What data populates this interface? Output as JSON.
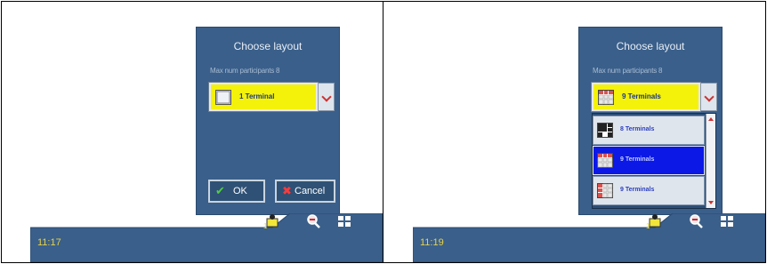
{
  "colors": {
    "dialog_bg": "#3a5f8a",
    "taskbar_bg": "#3a5f8a",
    "select_bg": "#f4f20a",
    "list_selected_bg": "#0b18e6",
    "clock_text": "#e6d24a"
  },
  "left": {
    "dialog": {
      "title": "Choose layout",
      "subtitle": "Max num participants 8",
      "selected_layout": "1 Terminal",
      "ok_label": "OK",
      "cancel_label": "Cancel"
    },
    "taskbar": {
      "clock": "11:17"
    }
  },
  "right": {
    "dialog": {
      "title": "Choose layout",
      "subtitle": "Max num participants 8",
      "selected_layout": "9 Terminals",
      "options": [
        "8 Terminals",
        "9 Terminals",
        "9 Terminals"
      ],
      "highlighted_index": 1
    },
    "taskbar": {
      "clock": "11:19"
    }
  },
  "icons": {
    "taskbar": [
      "person-terminal-icon",
      "zoom-icon",
      "layout-grid-icon"
    ],
    "buttons": [
      "check-icon",
      "x-icon"
    ],
    "dropdown": "chevron-down-icon"
  }
}
